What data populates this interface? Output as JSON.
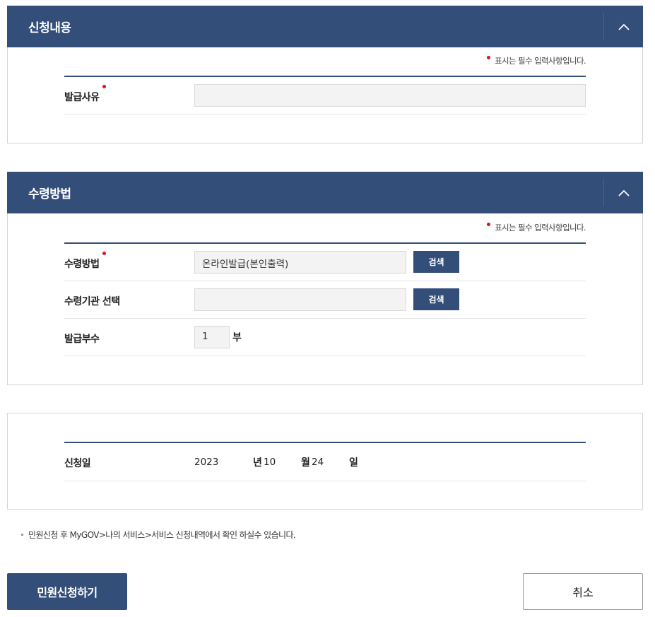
{
  "required_note": "표시는 필수 입력사항입니다.",
  "section1": {
    "title": "신청내용",
    "reason_label": "발급사유",
    "reason_value": ""
  },
  "section2": {
    "title": "수령방법",
    "method_label": "수령방법",
    "method_value": "온라인발급(본인출력)",
    "search_label": "검색",
    "agency_label": "수령기관 선택",
    "agency_value": "",
    "copies_label": "발급부수",
    "copies_value": "1",
    "copies_unit": "부"
  },
  "section3": {
    "date_label": "신청일",
    "year": "2023",
    "year_unit": "년",
    "month": "10",
    "month_unit": "월",
    "day": "24",
    "day_unit": "일"
  },
  "notice": "민원신청 후 MyGOV>나의 서비스>서비스 신청내역에서 확인 하실수 있습니다.",
  "buttons": {
    "submit": "민원신청하기",
    "cancel": "취소"
  },
  "colors": {
    "primary": "#344e7a",
    "required_dot": "#e0121c"
  }
}
